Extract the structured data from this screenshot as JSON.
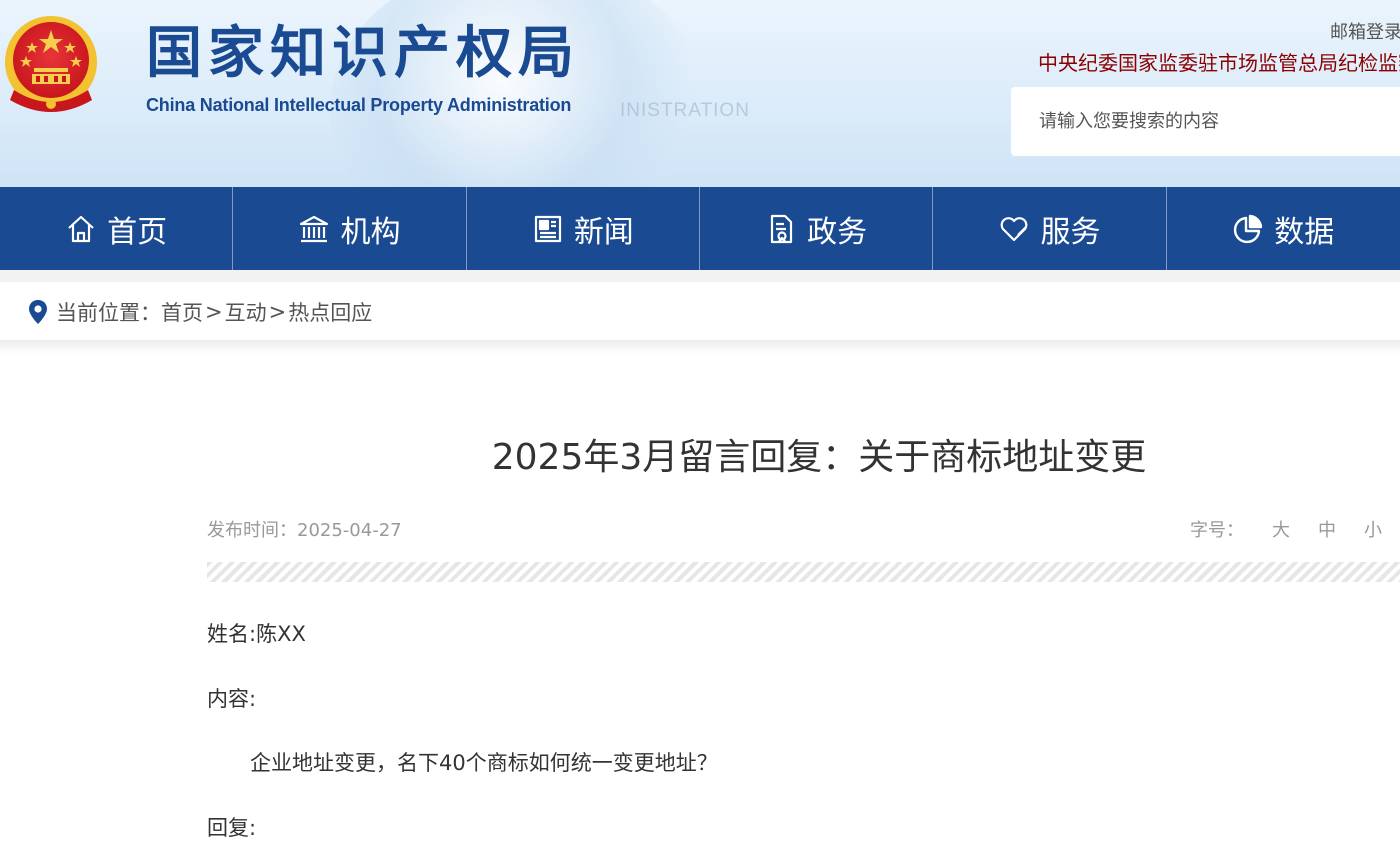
{
  "header": {
    "title": "国家知识产权局",
    "subtitle": "China National Intellectual Property Administration",
    "watermark": "INISTRATION",
    "mail_link": "邮箱登录",
    "jiwei_link": "中央纪委国家监委驻市场监管总局纪检监察组",
    "search_placeholder": "请输入您要搜索的内容"
  },
  "nav": {
    "items": [
      {
        "label": "首页",
        "icon": "home-icon"
      },
      {
        "label": "机构",
        "icon": "institution-icon"
      },
      {
        "label": "新闻",
        "icon": "newspaper-icon"
      },
      {
        "label": "政务",
        "icon": "document-icon"
      },
      {
        "label": "服务",
        "icon": "heart-icon"
      },
      {
        "label": "数据",
        "icon": "pie-chart-icon"
      }
    ]
  },
  "breadcrumb": {
    "prefix": "当前位置：",
    "items": [
      "首页",
      "互动",
      "热点回应"
    ],
    "separator": ">"
  },
  "article": {
    "title": "2025年3月留言回复：关于商标地址变更",
    "publish_label": "发布时间：2025-04-27",
    "font_size_label": "字号：",
    "font_sizes": [
      "大",
      "中",
      "小"
    ],
    "name_line": "姓名:陈XX",
    "content_label": "内容:",
    "content_text": "企业地址变更，名下40个商标如何统一变更地址？",
    "reply_label": "回复:"
  },
  "colors": {
    "brand_blue": "#1a4a91",
    "jiwei_red": "#8b0000"
  }
}
